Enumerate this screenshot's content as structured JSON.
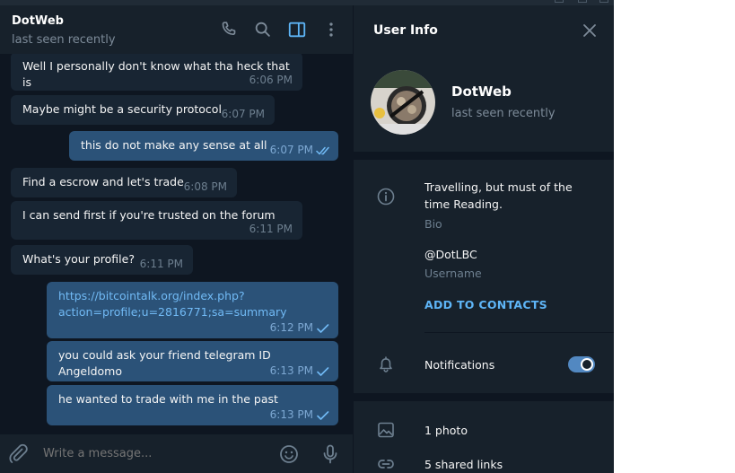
{
  "chat": {
    "title": "DotWeb",
    "status": "last seen recently",
    "composer_placeholder": "Write a message...",
    "messages": [
      {
        "direction": "in",
        "text": "Well I personally don't know what tha heck that is",
        "time": "6:06 PM"
      },
      {
        "direction": "in",
        "text": "Maybe might be a security protocol",
        "time": "6:07 PM"
      },
      {
        "direction": "out",
        "text": "this do not make any sense at all",
        "time": "6:07 PM",
        "status": "read"
      },
      {
        "direction": "in",
        "text": "Find a escrow and let's trade",
        "time": "6:08 PM"
      },
      {
        "direction": "in",
        "text": "I can send first if you're trusted on the forum",
        "time": "6:11 PM"
      },
      {
        "direction": "in",
        "text": "What's your profile?",
        "time": "6:11 PM"
      },
      {
        "direction": "out",
        "link_line1": "https://bitcointalk.org/index.php?",
        "link_line2": "action=profile;u=2816771;sa=summary",
        "time": "6:12 PM",
        "status": "sent"
      },
      {
        "direction": "out",
        "text": "you could ask your friend telegram ID Angeldomo",
        "time": "6:13 PM",
        "status": "sent"
      },
      {
        "direction": "out",
        "text": "he wanted to trade with me in the past",
        "time": "6:13 PM",
        "status": "sent"
      }
    ]
  },
  "info": {
    "title": "User Info",
    "name": "DotWeb",
    "status": "last seen recently",
    "bio_line1": "Travelling, but must of the",
    "bio_line2": "time Reading.",
    "bio_label": "Bio",
    "username": "@DotLBC",
    "username_label": "Username",
    "add_contacts": "ADD TO CONTACTS",
    "notifications_label": "Notifications",
    "notifications_on": true,
    "photos": "1 photo",
    "shared_links": "5 shared links"
  },
  "icons": [
    "phone-icon",
    "search-icon",
    "sidebar-toggle-icon",
    "more-vert-icon",
    "attach-icon",
    "emoji-icon",
    "microphone-icon",
    "close-icon",
    "info-icon",
    "bell-icon",
    "photo-icon",
    "link-icon",
    "double-check-icon",
    "check-icon"
  ],
  "colors": {
    "background": "#0e1621",
    "panel": "#17212b",
    "incoming_bubble": "#182533",
    "outgoing_bubble": "#2b5278",
    "accent": "#5288c1",
    "link": "#71baf5"
  }
}
